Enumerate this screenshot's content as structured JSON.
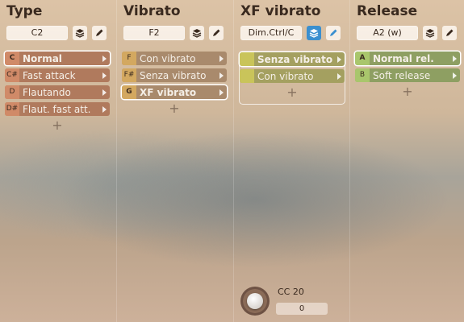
{
  "columns": [
    {
      "title": "Type",
      "preset": "C2",
      "articulations": [
        {
          "key": "C",
          "label": "Normal"
        },
        {
          "key": "C#",
          "label": "Fast attack"
        },
        {
          "key": "D",
          "label": "Flautando"
        },
        {
          "key": "D#",
          "label": "Flaut. fast att."
        }
      ],
      "selected_index": 0
    },
    {
      "title": "Vibrato",
      "preset": "F2",
      "articulations": [
        {
          "key": "F",
          "label": "Con vibrato"
        },
        {
          "key": "F#",
          "label": "Senza vibrato"
        },
        {
          "key": "G",
          "label": "XF vibrato"
        }
      ],
      "selected_index": 2
    },
    {
      "title": "XF vibrato",
      "preset": "Dim.Ctrl/C",
      "articulations": [
        {
          "key": "",
          "label": "Senza vibrato"
        },
        {
          "key": "",
          "label": "Con vibrato"
        }
      ],
      "selected_index": 0
    },
    {
      "title": "Release",
      "preset": "A2 (w)",
      "articulations": [
        {
          "key": "A",
          "label": "Normal rel."
        },
        {
          "key": "B",
          "label": "Soft release"
        }
      ],
      "selected_index": 0
    }
  ],
  "add_symbol": "+",
  "controller": {
    "label": "CC 20",
    "value": "0"
  },
  "icons": {
    "layers": "layers-icon",
    "edit": "pencil-icon",
    "arrow": "triangle-right-icon"
  },
  "colors": {
    "type_body": "#b07a5d",
    "type_key": "#d08a68",
    "vibrato_body": "#a98a6c",
    "vibrato_key": "#d3a860",
    "xf_body": "#a4a060",
    "xf_key": "#c9c45a",
    "release_body": "#8e9f62",
    "release_key": "#a9c66c",
    "active_icon": "#3a8fcf"
  }
}
